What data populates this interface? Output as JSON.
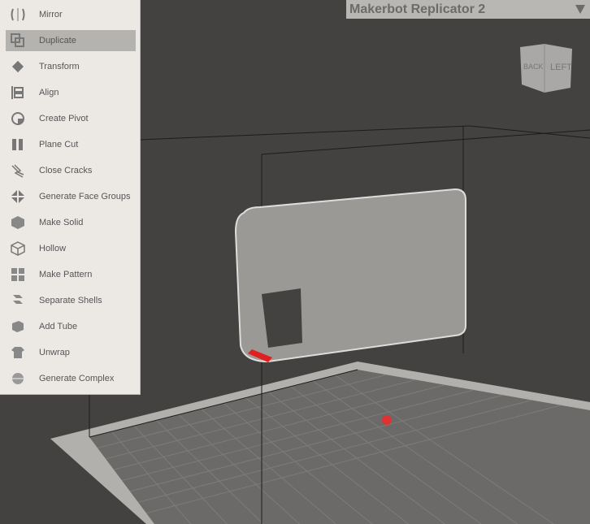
{
  "menu": {
    "items": [
      {
        "label": "Mirror",
        "icon": "mirror-icon"
      },
      {
        "label": "Duplicate",
        "icon": "duplicate-icon",
        "selected": true
      },
      {
        "label": "Transform",
        "icon": "transform-icon"
      },
      {
        "label": "Align",
        "icon": "align-icon"
      },
      {
        "label": "Create Pivot",
        "icon": "pivot-icon"
      },
      {
        "label": "Plane Cut",
        "icon": "plane-cut-icon"
      },
      {
        "label": "Close Cracks",
        "icon": "close-cracks-icon"
      },
      {
        "label": "Generate Face Groups",
        "icon": "face-groups-icon"
      },
      {
        "label": "Make Solid",
        "icon": "make-solid-icon"
      },
      {
        "label": "Hollow",
        "icon": "hollow-icon"
      },
      {
        "label": "Make Pattern",
        "icon": "pattern-icon"
      },
      {
        "label": "Separate Shells",
        "icon": "separate-shells-icon"
      },
      {
        "label": "Add Tube",
        "icon": "tube-icon"
      },
      {
        "label": "Unwrap",
        "icon": "unwrap-icon"
      },
      {
        "label": "Generate Complex",
        "icon": "complex-icon"
      }
    ]
  },
  "printer": {
    "selected": "Makerbot Replicator 2"
  },
  "viewcube": {
    "back": "BACK",
    "left": "LEFT"
  }
}
